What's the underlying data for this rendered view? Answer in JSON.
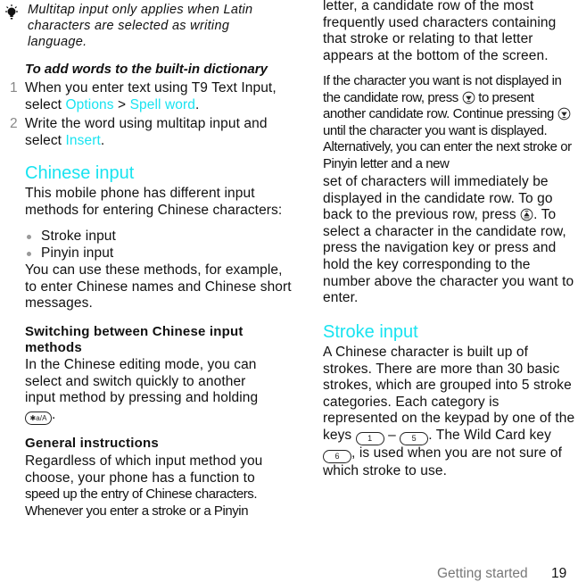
{
  "tip": {
    "icon": "lightbulb-icon",
    "text": "Multitap input only applies when Latin characters are selected as writing language."
  },
  "procedure": {
    "title": "To add words to the built-in dictionary",
    "steps": [
      {
        "number": "1",
        "text_before": "When you enter text using T9 Text Input, select ",
        "link1": "Options",
        "separator": " > ",
        "link2": "Spell word",
        "text_after": "."
      },
      {
        "number": "2",
        "text_before": "Write the word using multitap input and select ",
        "link1": "Insert",
        "text_after": "."
      }
    ]
  },
  "chinese_input": {
    "heading": "Chinese input",
    "intro": "This mobile phone has different input methods for entering Chinese characters:",
    "bullets": [
      "Stroke input",
      "Pinyin input"
    ],
    "usage": "You can use these methods, for example, to enter Chinese names and Chinese short messages."
  },
  "switching": {
    "heading": "Switching between Chinese input methods",
    "text_before": "In the Chinese editing mode, you can select and switch quickly to another input method by pressing and holding ",
    "key_label": "✱a/A",
    "key_icon": "star-key-icon",
    "text_after": "."
  },
  "general": {
    "heading": "General instructions",
    "para1_a": "Regardless of which input method you choose, your phone has a function to ",
    "para1_b": "speed up the entry of Chinese characters. Whenever you enter a stroke or a Pinyin",
    "para1_c": "letter, a candidate row of the most frequently used characters containing that stroke or relating to that letter appears at the bottom of the screen.",
    "para2_a": "If the character you want is not displayed in the candidate row, press ",
    "para2_a2": " to present another candidate row. Continue pressing ",
    "para2_b": " until the character you want is displayed. Alternatively, you can enter the next stroke or Pinyin letter and a new",
    "para2_c": "set of characters will immediately be displayed in the candidate row. To go back to the previous row, press ",
    "para2_d": ". To select a character in the candidate row, press the navigation key or press and hold the key corresponding to the number above the character you want to enter.",
    "nav_down_icon": "nav-down-icon",
    "nav_up_icon": "nav-up-icon"
  },
  "stroke_input": {
    "heading": "Stroke input",
    "text_a": "A Chinese character is built up of strokes. There are more than 30 basic strokes, which are grouped into 5 stroke categories. Each category is represented on the keypad by one of the keys ",
    "key_from": "1",
    "dash": " – ",
    "key_to": "5",
    "text_b": ". The Wild Card key ",
    "wild_key": "6",
    "text_c": ", is used when you are not sure of which stroke to use."
  },
  "footer": {
    "section": "Getting started",
    "page_number": "19"
  },
  "colors": {
    "accent": "#19e3f0",
    "text": "#111111",
    "muted": "#888888"
  }
}
